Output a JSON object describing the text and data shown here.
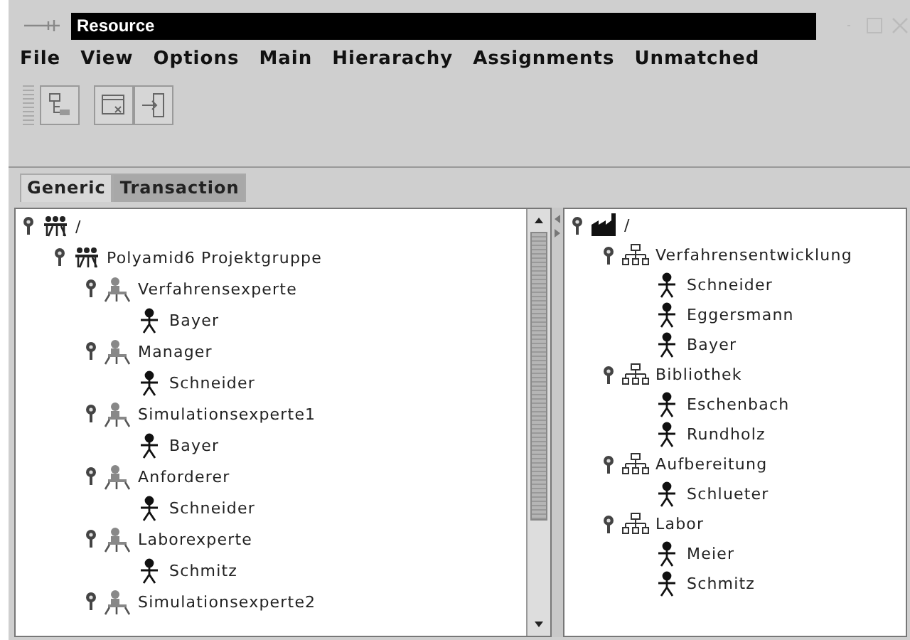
{
  "window": {
    "title": "Resource"
  },
  "menu": [
    "File",
    "View",
    "Options",
    "Main",
    "Hierarachy",
    "Assignments",
    "Unmatched"
  ],
  "tabs": [
    {
      "label": "Generic",
      "selected": true
    },
    {
      "label": "Transaction",
      "selected": false
    }
  ],
  "left_tree": [
    {
      "label": "/",
      "kind": "group",
      "expanded": true,
      "children": [
        {
          "label": "Polyamid6 Projektgruppe",
          "kind": "group",
          "expanded": true,
          "children": [
            {
              "label": "Verfahrensexperte",
              "kind": "role",
              "expanded": true,
              "children": [
                {
                  "label": "Bayer",
                  "kind": "person"
                }
              ]
            },
            {
              "label": "Manager",
              "kind": "role",
              "expanded": true,
              "children": [
                {
                  "label": "Schneider",
                  "kind": "person"
                }
              ]
            },
            {
              "label": "Simulationsexperte1",
              "kind": "role",
              "expanded": true,
              "children": [
                {
                  "label": "Bayer",
                  "kind": "person"
                }
              ]
            },
            {
              "label": "Anforderer",
              "kind": "role",
              "expanded": true,
              "children": [
                {
                  "label": "Schneider",
                  "kind": "person"
                }
              ]
            },
            {
              "label": "Laborexperte",
              "kind": "role",
              "expanded": true,
              "children": [
                {
                  "label": "Schmitz",
                  "kind": "person"
                }
              ]
            },
            {
              "label": "Simulationsexperte2",
              "kind": "role",
              "expanded": true
            }
          ]
        }
      ]
    }
  ],
  "right_tree": [
    {
      "label": "/",
      "kind": "factory",
      "expanded": true,
      "children": [
        {
          "label": "Verfahrensentwicklung",
          "kind": "org",
          "expanded": true,
          "children": [
            {
              "label": "Schneider",
              "kind": "person"
            },
            {
              "label": "Eggersmann",
              "kind": "person"
            },
            {
              "label": "Bayer",
              "kind": "person"
            }
          ]
        },
        {
          "label": "Bibliothek",
          "kind": "org",
          "expanded": true,
          "children": [
            {
              "label": "Eschenbach",
              "kind": "person"
            },
            {
              "label": "Rundholz",
              "kind": "person"
            }
          ]
        },
        {
          "label": "Aufbereitung",
          "kind": "org",
          "expanded": true,
          "children": [
            {
              "label": "Schlueter",
              "kind": "person"
            }
          ]
        },
        {
          "label": "Labor",
          "kind": "org",
          "expanded": true,
          "children": [
            {
              "label": "Meier",
              "kind": "person"
            },
            {
              "label": "Schmitz",
              "kind": "person"
            }
          ]
        }
      ]
    }
  ]
}
